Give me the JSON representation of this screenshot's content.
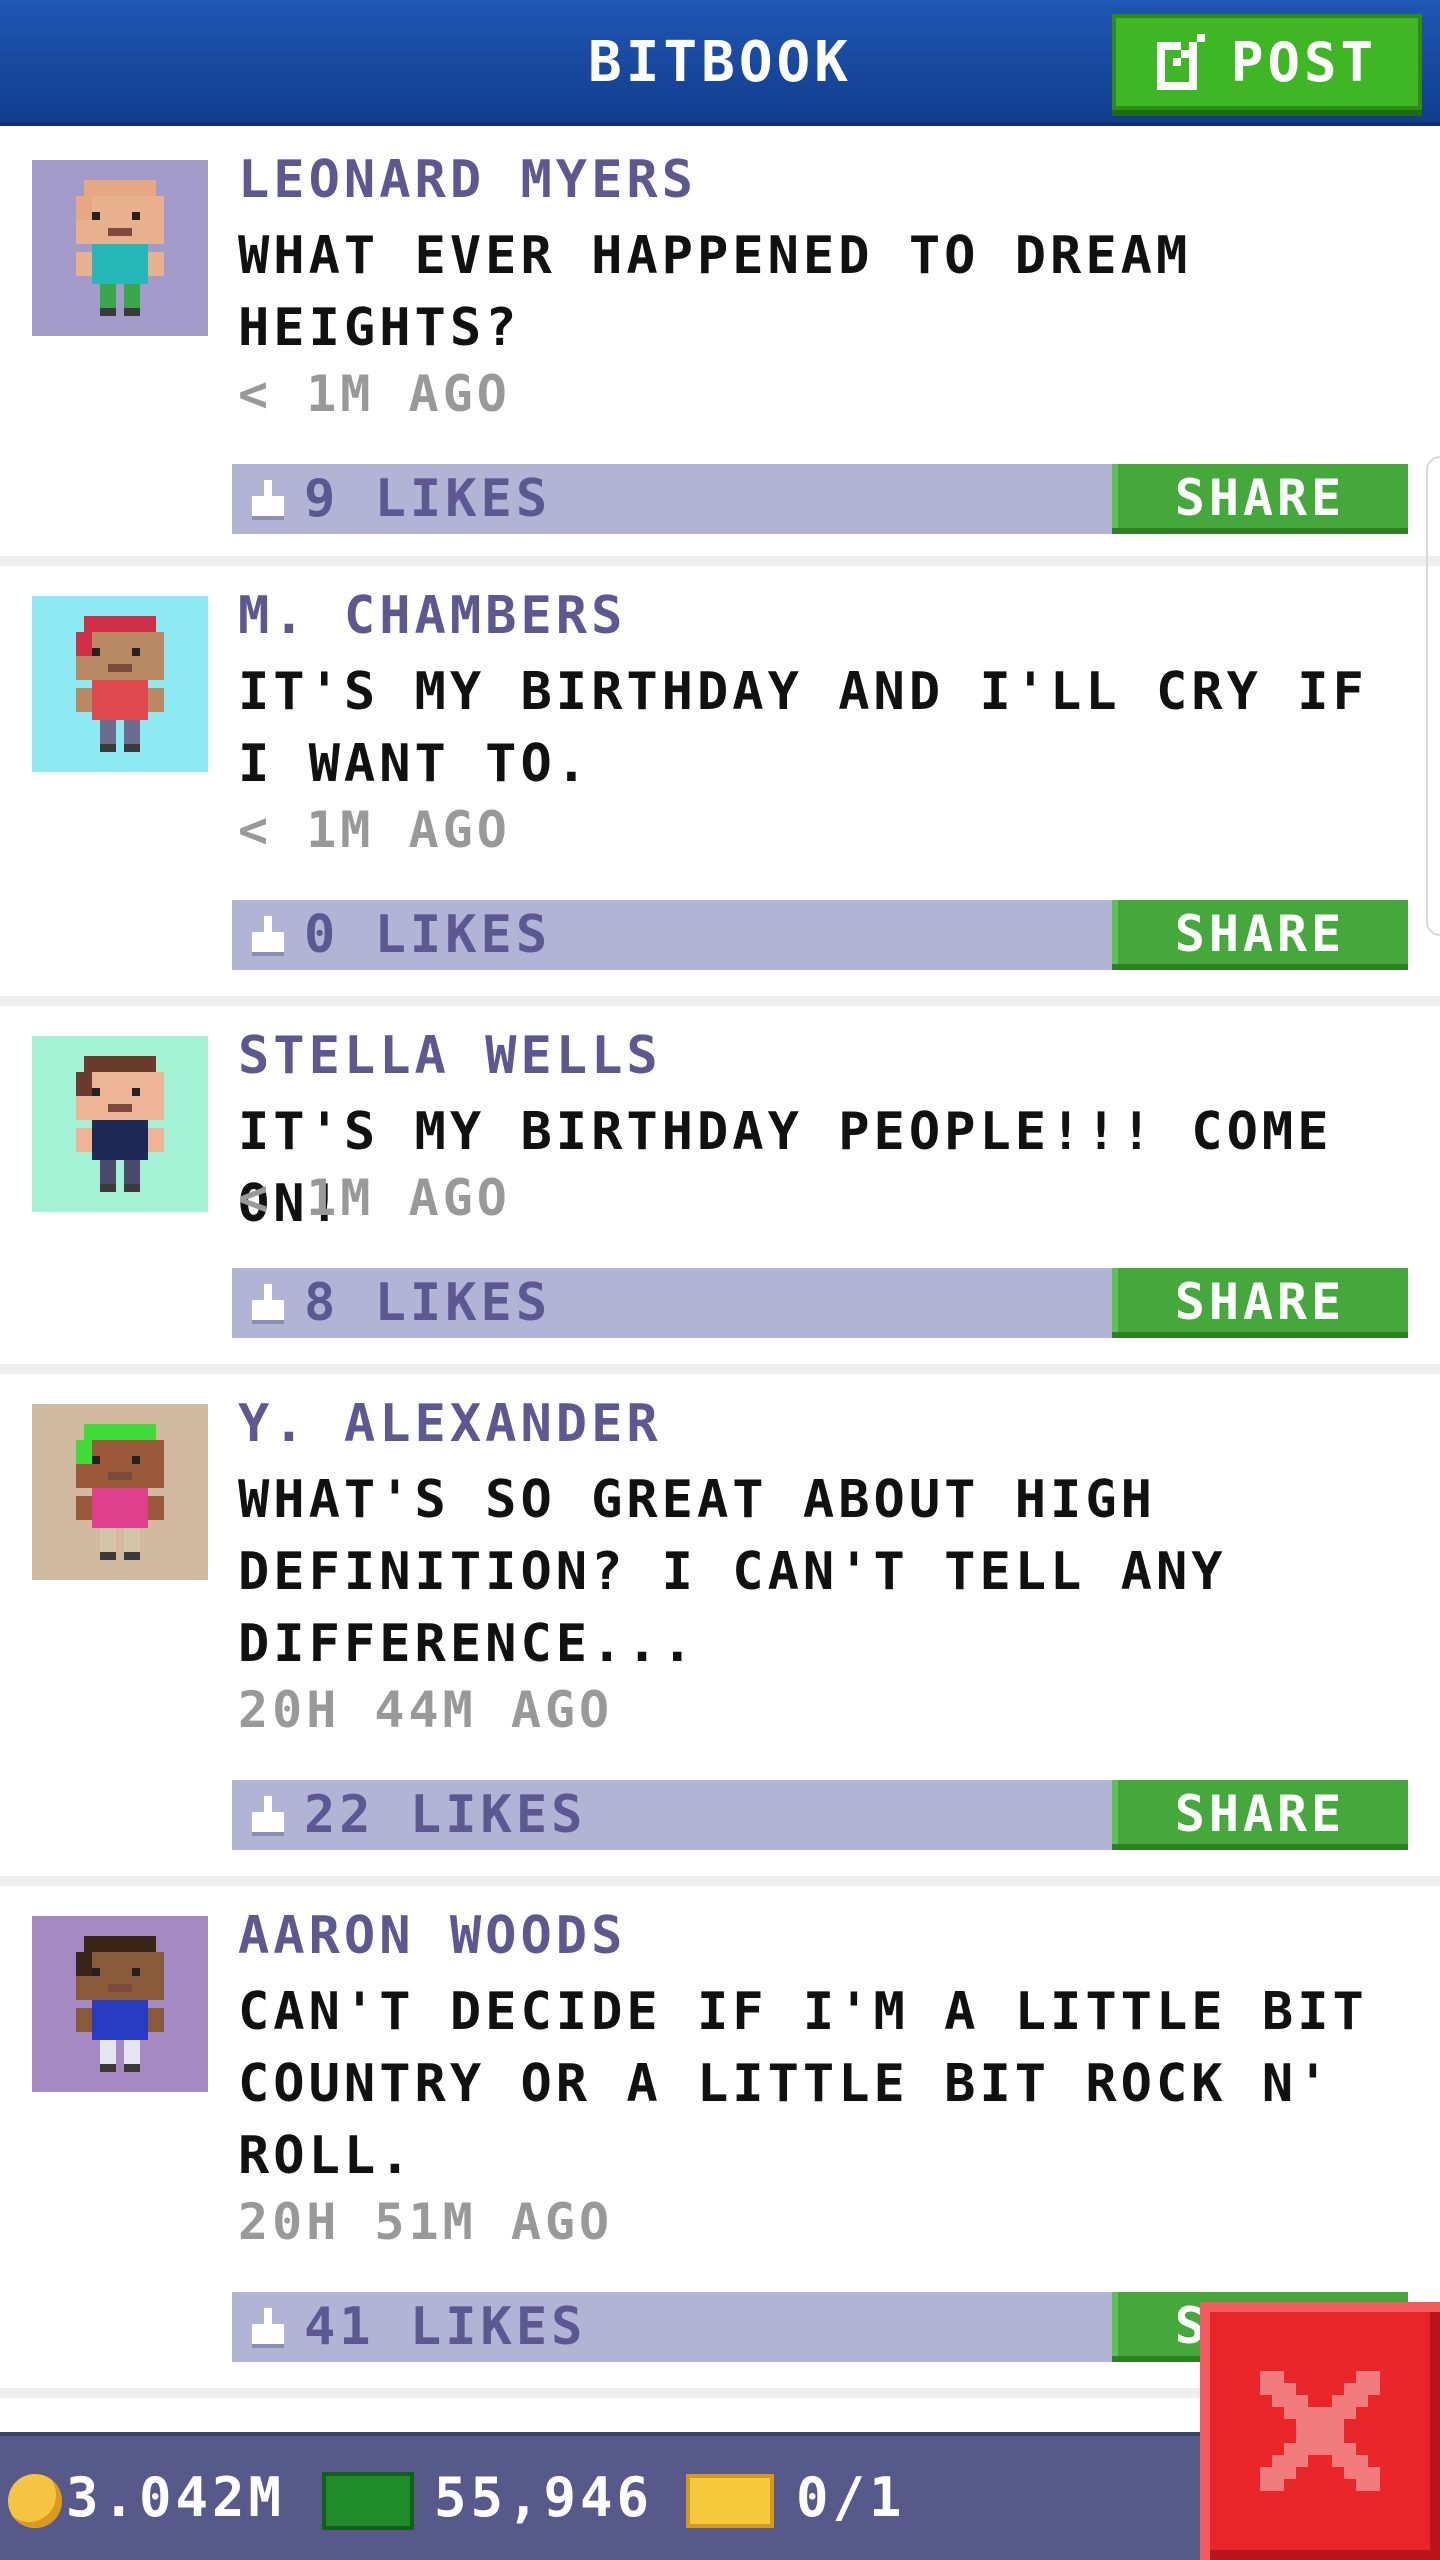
{
  "header": {
    "title": "BITBOOK",
    "post_label": "POST"
  },
  "posts": [
    {
      "author": "LEONARD MYERS",
      "message": "WHAT EVER HAPPENED TO DREAM HEIGHTS?",
      "time": "< 1M AGO",
      "likes": "9 LIKES",
      "share": "SHARE",
      "avatar_bg": "#a39ccb",
      "shirt": "#26b7b9",
      "hair": "#e6a883",
      "skin": "#e8b08c",
      "pants": "#3aa64c"
    },
    {
      "author": "M. CHAMBERS",
      "message": "IT'S MY BIRTHDAY AND I'LL CRY IF I WANT TO.",
      "time": "< 1M AGO",
      "likes": "0 LIKES",
      "share": "SHARE",
      "avatar_bg": "#8de9f2",
      "shirt": "#e0494d",
      "hair": "#cf2f47",
      "skin": "#b98a63",
      "pants": "#6a6a8c"
    },
    {
      "author": "STELLA WELLS",
      "message": "IT'S MY BIRTHDAY PEOPLE!!! COME ON!",
      "time": "< 1M AGO",
      "likes": "8 LIKES",
      "share": "SHARE",
      "avatar_bg": "#a4f2d6",
      "shirt": "#1c2a55",
      "hair": "#6a3a2a",
      "skin": "#edb596",
      "pants": "#4a4a6a"
    },
    {
      "author": "Y. ALEXANDER",
      "message": "WHAT'S SO GREAT ABOUT HIGH DEFINITION? I CAN'T TELL ANY DIFFERENCE...",
      "time": "20H 44M AGO",
      "likes": "22 LIKES",
      "share": "SHARE",
      "avatar_bg": "#d2baa0",
      "shirt": "#e1408f",
      "hair": "#3fdc3a",
      "skin": "#9a5a3a",
      "pants": "#d4c4a8"
    },
    {
      "author": "AARON WOODS",
      "message": "CAN'T DECIDE IF I'M A LITTLE BIT COUNTRY OR A LITTLE BIT ROCK N' ROLL.",
      "time": "20H 51M AGO",
      "likes": "41 LIKES",
      "share": "SHARE",
      "avatar_bg": "#a58ac4",
      "shirt": "#2a3bc4",
      "hair": "#3a2418",
      "skin": "#8a5a3a",
      "pants": "#e6e6f0"
    }
  ],
  "footer": {
    "coins": "3.042M",
    "cash": "55,946",
    "tickets": "0/1"
  },
  "colors": {
    "header_blue": "#1a4ea6",
    "post_green": "#3fb624",
    "like_bar": "#b2b4d6",
    "author_purple": "#5e5891",
    "close_red": "#e8262a"
  }
}
